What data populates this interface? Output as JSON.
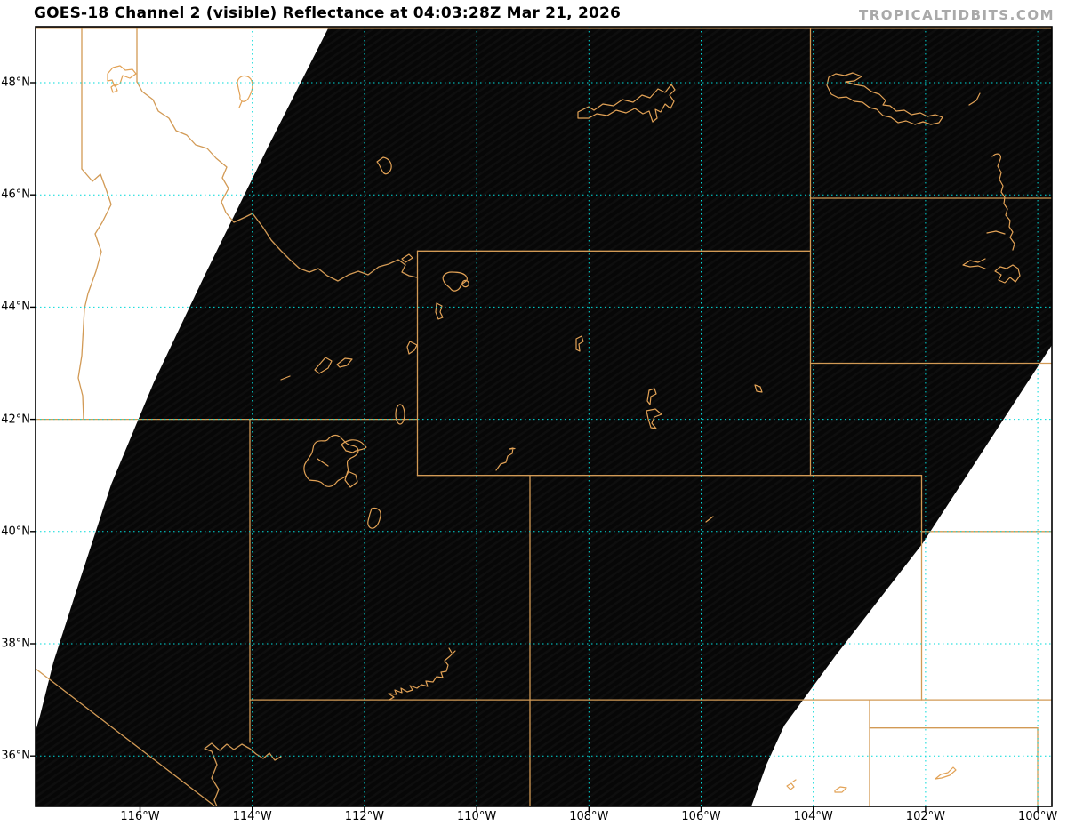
{
  "header": {
    "title": "GOES-18 Channel 2 (visible) Reflectance at 04:03:28Z Mar 21, 2026",
    "watermark": "TROPICALTIDBITS.COM"
  },
  "map": {
    "satellite": "GOES-18",
    "channel": "Channel 2 (visible)",
    "product": "Reflectance",
    "time": "04:03:28Z",
    "date": "Mar 21, 2026",
    "x_axis": {
      "labels": [
        "116°W",
        "114°W",
        "112°W",
        "110°W",
        "108°W",
        "106°W",
        "104°W",
        "102°W",
        "100°W"
      ]
    },
    "y_axis": {
      "labels": [
        "48°N",
        "46°N",
        "44°N",
        "42°N",
        "40°N",
        "38°N",
        "36°N"
      ]
    },
    "colors": {
      "satellite_fill": "#070707",
      "no_data": "#ffffff",
      "grid": "#00d9d9",
      "state_border": "#d29a55",
      "lake_outline": "#e2a256",
      "canada_border": "#d8a464",
      "frame": "#000000",
      "title_text": "#000000",
      "watermark_text": "#a9a9a9"
    }
  }
}
